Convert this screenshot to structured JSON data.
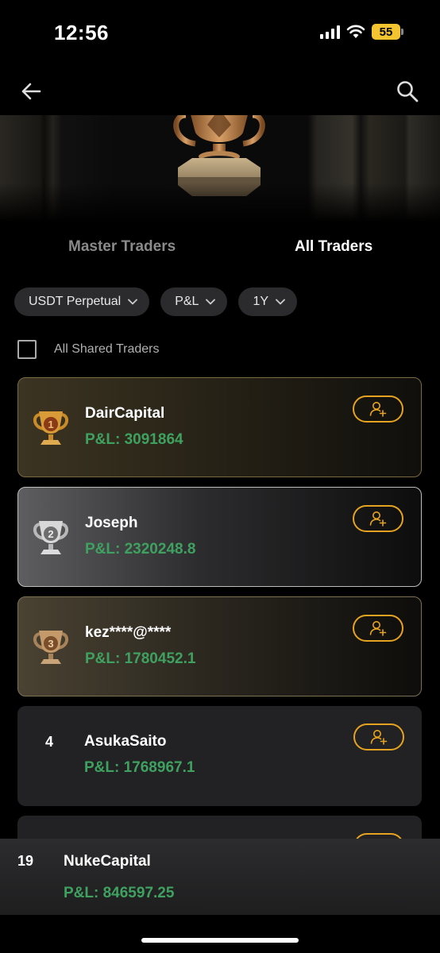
{
  "status_bar": {
    "time": "12:56",
    "battery": "55"
  },
  "tabs": {
    "master": "Master Traders",
    "all": "All Traders"
  },
  "filters": [
    {
      "label": "USDT Perpetual"
    },
    {
      "label": "P&L"
    },
    {
      "label": "1Y"
    }
  ],
  "shared_label": "All Shared Traders",
  "traders": [
    {
      "rank": "1",
      "name": "DairCapital",
      "pnl": "P&L: 3091864"
    },
    {
      "rank": "2",
      "name": "Joseph",
      "pnl": "P&L: 2320248.8"
    },
    {
      "rank": "3",
      "name": "kez****@****",
      "pnl": "P&L: 1780452.1"
    },
    {
      "rank": "4",
      "name": "AsukaSaito",
      "pnl": "P&L: 1768967.1"
    }
  ],
  "self": {
    "rank": "19",
    "name": "NukeCapital",
    "pnl": "P&L: 846597.25"
  },
  "colors": {
    "accent": "#e6a321",
    "profit": "#3fa160",
    "chip_bg": "#2b2b2d"
  }
}
